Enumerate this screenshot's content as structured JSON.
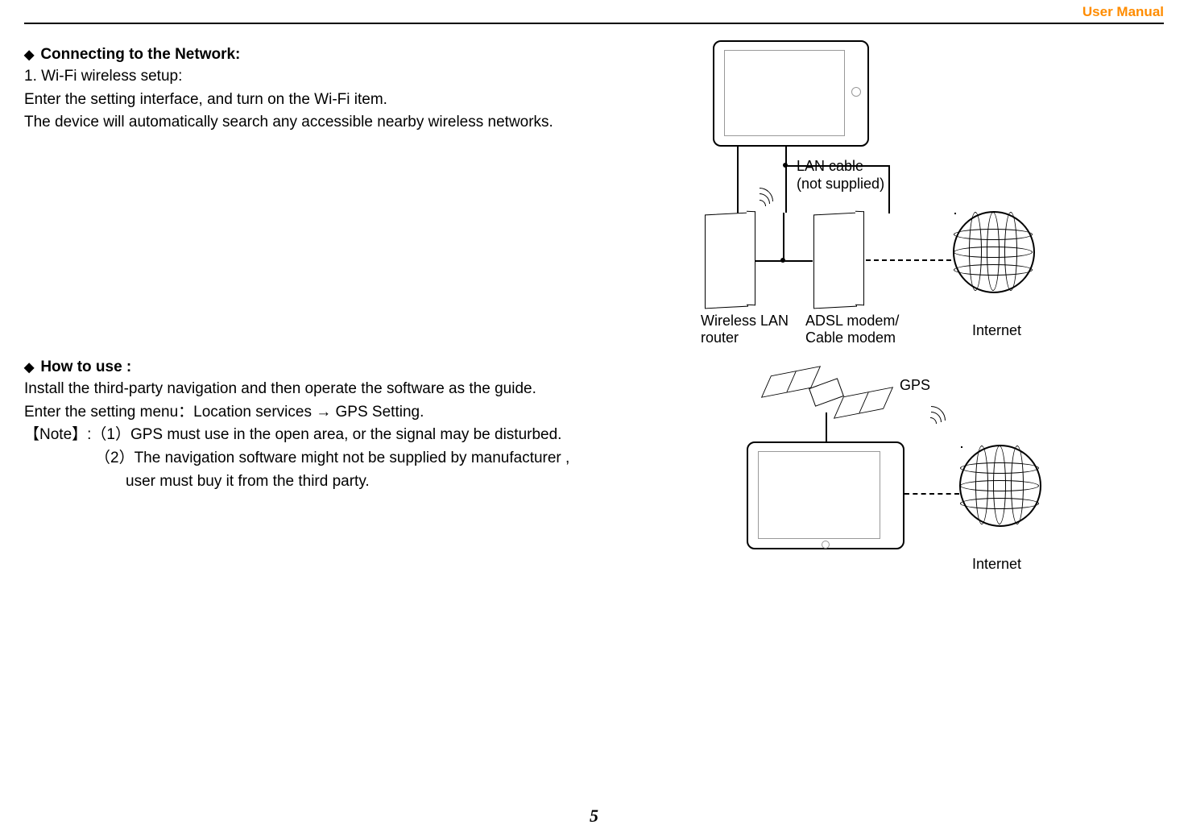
{
  "header": {
    "title": "User Manual"
  },
  "section1": {
    "heading": "Connecting to the Network:",
    "line1": "1. Wi-Fi wireless setup:",
    "line2": "Enter the setting interface, and turn on the Wi-Fi item.",
    "line3": "The device will automatically search any accessible nearby wireless networks."
  },
  "section2": {
    "heading": "How to use :",
    "line1": "Install the third-party navigation and then operate the software as the guide.",
    "line2": "Enter the setting menu：Location services → GPS Setting.",
    "line3": "【Note】:（1）GPS must use in the open area, or the signal may be disturbed.",
    "line4": "（2）The navigation software might not be supplied by manufacturer ,",
    "line5": "user must buy it from the third party."
  },
  "diagram": {
    "lan_cable": "LAN cable",
    "not_supplied": "(not supplied)",
    "wireless_lan": "Wireless LAN",
    "router": "router",
    "adsl": "ADSL modem/",
    "cable_modem": "Cable modem",
    "internet1": "Internet",
    "gps": "GPS",
    "internet2": "Internet"
  },
  "page_number": "5"
}
